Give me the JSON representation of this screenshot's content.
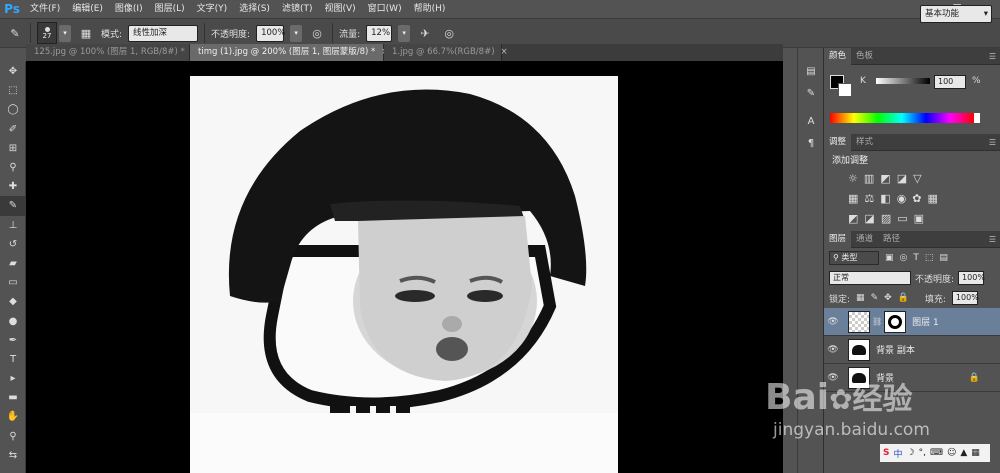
{
  "app": {
    "logo": "Ps"
  },
  "menu": [
    "文件(F)",
    "编辑(E)",
    "图像(I)",
    "图层(L)",
    "文字(Y)",
    "选择(S)",
    "滤镜(T)",
    "视图(V)",
    "窗口(W)",
    "帮助(H)"
  ],
  "options": {
    "brush_size": "27",
    "mode_label": "模式:",
    "mode_value": "线性加深",
    "opacity_label": "不透明度:",
    "opacity_value": "100%",
    "flow_label": "流量:",
    "flow_value": "12%",
    "workspace": "基本功能"
  },
  "tabs": [
    {
      "label": "125.jpg @ 100% (图层 1, RGB/8#) *",
      "active": false
    },
    {
      "label": "timg (1).jpg @ 200% (图层 1, 图层蒙版/8) *",
      "active": true
    },
    {
      "label": "1.jpg @ 66.7%(RGB/8#)",
      "active": false
    }
  ],
  "color_panel": {
    "tabs": [
      "颜色",
      "色板"
    ],
    "channel": "K",
    "value": "100",
    "unit": "%"
  },
  "adjust_panel": {
    "tabs": [
      "调整",
      "样式"
    ],
    "title": "添加调整"
  },
  "layers_panel": {
    "tabs": [
      "图层",
      "通道",
      "路径"
    ],
    "filter_label": "类型",
    "blend_mode": "正常",
    "opacity_label": "不透明度:",
    "opacity_value": "100%",
    "lock_label": "锁定:",
    "fill_label": "填充:",
    "fill_value": "100%",
    "layers": [
      {
        "name": "图层 1",
        "selected": true
      },
      {
        "name": "背景 副本",
        "selected": false
      },
      {
        "name": "背景",
        "selected": false
      }
    ]
  },
  "watermark": {
    "brand": "Bai",
    "brand_cn": "经验",
    "url": "jingyan.baidu.com",
    "ime": "中"
  },
  "colors": {
    "accent": "#31a8ff",
    "selected_layer": "#6a7f9a"
  }
}
